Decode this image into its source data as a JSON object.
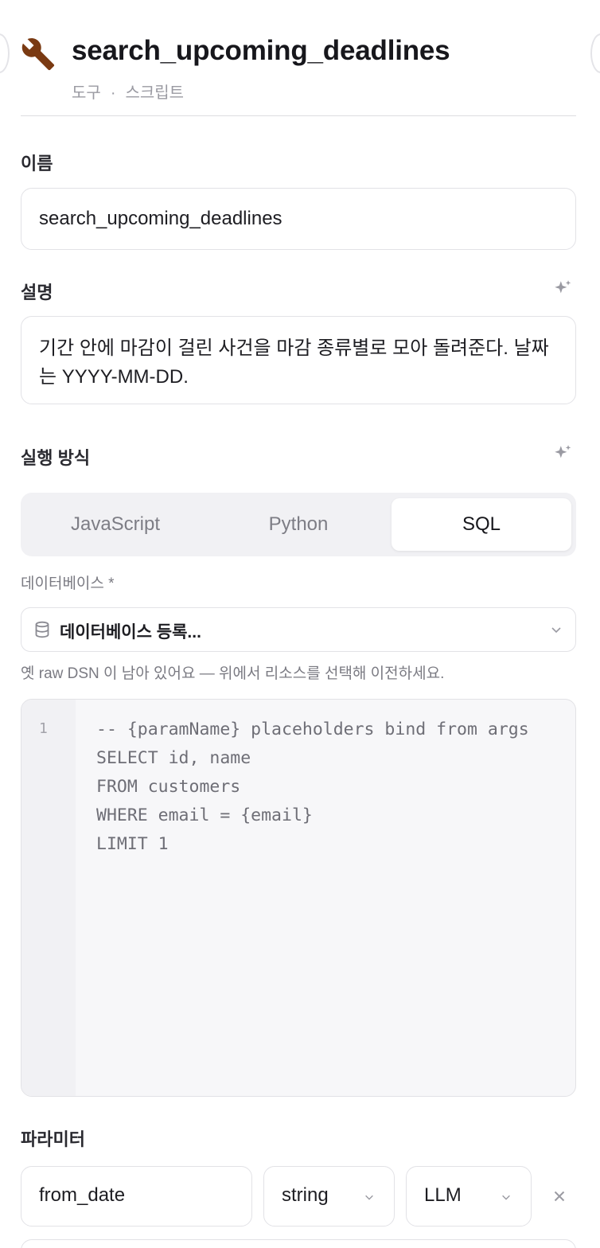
{
  "header": {
    "icon": "wrench-icon",
    "title": "search_upcoming_deadlines",
    "subtitle_type": "도구",
    "subtitle_separator": "·",
    "subtitle_kind": "스크립트"
  },
  "name_section": {
    "label": "이름",
    "value": "search_upcoming_deadlines"
  },
  "description_section": {
    "label": "설명",
    "value": "기간 안에 마감이 걸린 사건을 마감 종류별로 모아 돌려준다. 날짜는 YYYY-MM-DD.",
    "ai_icon": "sparkle-icon"
  },
  "execution_section": {
    "label": "실행 방식",
    "ai_icon": "sparkle-icon",
    "tabs": [
      {
        "label": "JavaScript",
        "active": false
      },
      {
        "label": "Python",
        "active": false
      },
      {
        "label": "SQL",
        "active": true
      }
    ]
  },
  "database": {
    "label": "데이터베이스 *",
    "icon": "database-icon",
    "selected": "데이터베이스 등록...",
    "hint": "옛 raw DSN 이 남아 있어요 — 위에서 리소스를 선택해 이전하세요."
  },
  "editor": {
    "line_number": "1",
    "code": "-- {paramName} placeholders bind from args\nSELECT id, name\nFROM customers\nWHERE email = {email}\nLIMIT 1"
  },
  "parameters": {
    "label": "파라미터",
    "rows": [
      {
        "name": "from_date",
        "type": "string",
        "source": "LLM"
      }
    ]
  },
  "colors": {
    "accent": "#17171c",
    "icon_brown": "#7a3a12",
    "border": "#e2e2e6",
    "muted_text": "#7a7a82"
  }
}
